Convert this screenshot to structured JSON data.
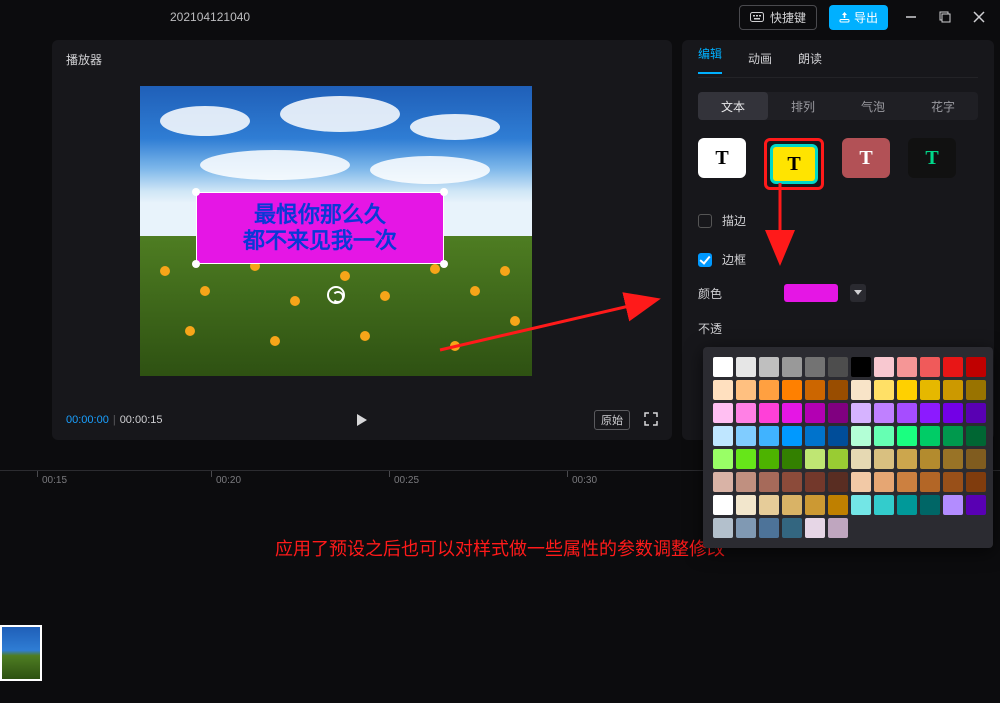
{
  "titlebar": {
    "project_name": "202104121040",
    "shortcut_label": "快捷键",
    "export_label": "导出"
  },
  "player": {
    "header": "播放器",
    "text_line1": "最恨你那么久",
    "text_line2": "都不来见我一次",
    "time_current": "00:00:00",
    "time_total": "00:00:15",
    "ratio_label": "原始"
  },
  "right": {
    "tabs": [
      "编辑",
      "动画",
      "朗读"
    ],
    "subtabs": [
      "文本",
      "排列",
      "气泡",
      "花字"
    ],
    "preset_glyph": "T",
    "opt_stroke_label": "描边",
    "opt_border_label": "边框",
    "color_label": "颜色",
    "truncated_label": "不透"
  },
  "timeline": {
    "ticks": [
      "00:15",
      "00:20",
      "00:25",
      "00:30"
    ]
  },
  "caption": "应用了预设之后也可以对样式做一些属性的参数调整修改",
  "palette_colors": [
    "#ffffff",
    "#e6e6e6",
    "#bfbfbf",
    "#999999",
    "#737373",
    "#4d4d4d",
    "#000000",
    "#f8c8d0",
    "#f59696",
    "#f05a5a",
    "#e81616",
    "#c00000",
    "#ffe0bf",
    "#ffc080",
    "#ffa040",
    "#ff8000",
    "#cc6600",
    "#994d00",
    "#f8e4c8",
    "#ffe066",
    "#ffd000",
    "#e6b800",
    "#cc9900",
    "#997300",
    "#ffbff2",
    "#ff80e5",
    "#ff40d8",
    "#e516e5",
    "#b300b3",
    "#800080",
    "#d6b3ff",
    "#c080ff",
    "#a64dff",
    "#8c1aff",
    "#7300e6",
    "#5900b3",
    "#bfe6ff",
    "#80ccff",
    "#40b3ff",
    "#0099ff",
    "#0073cc",
    "#004d99",
    "#b3ffd6",
    "#66ffb3",
    "#1aff80",
    "#00cc66",
    "#00994d",
    "#006633",
    "#99ff66",
    "#66e619",
    "#4db300",
    "#338000",
    "#bfe673",
    "#99cc33",
    "#e6d9b3",
    "#d9c080",
    "#cca64d",
    "#b38b2e",
    "#997326",
    "#805c1f",
    "#d9b3a6",
    "#c09080",
    "#a66a5a",
    "#8c4b3a",
    "#73382b",
    "#592d22",
    "#f2c9a6",
    "#e6a673",
    "#cc8040",
    "#b36626",
    "#995019",
    "#803c0d",
    "#ffffff",
    "#f2e6cc",
    "#e6cc99",
    "#d9b366",
    "#cc9933",
    "#bf8000",
    "#73e6e6",
    "#33cccc",
    "#009999",
    "#006666",
    "#b38cff",
    "#5900b3",
    "#b3c0cc",
    "#8099b3",
    "#4d7399",
    "#336680",
    "#e6d6e6",
    "#bfa6bf"
  ]
}
